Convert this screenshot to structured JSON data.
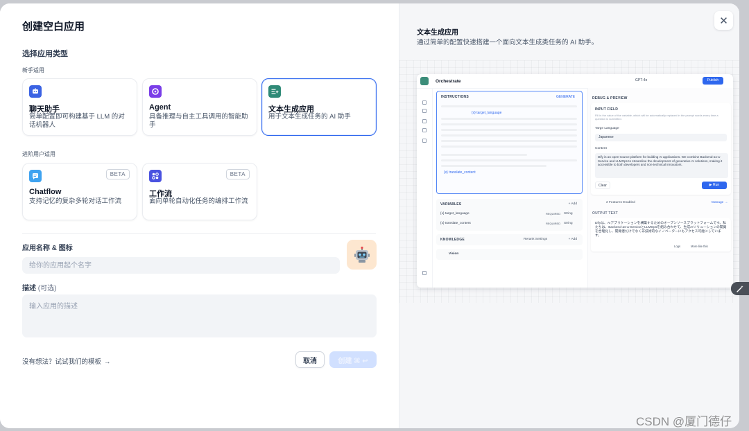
{
  "dialog": {
    "title": "创建空白应用",
    "section_title": "选择应用类型",
    "beginner_label": "新手适用",
    "advanced_label": "进阶用户适用"
  },
  "app_types": [
    {
      "name": "聊天助手",
      "desc": "简单配置即可构建基于 LLM 的对话机器人",
      "icon": "chat-bot-icon",
      "color": "#3b63e3",
      "selected": false
    },
    {
      "name": "Agent",
      "desc": "具备推理与自主工具调用的智能助手",
      "icon": "agent-icon",
      "color": "#7a3ee8",
      "selected": false
    },
    {
      "name": "文本生成应用",
      "desc": "用于文本生成任务的 AI 助手",
      "icon": "text-generation-icon",
      "color": "#2f8a77",
      "selected": true
    },
    {
      "name": "Chatflow",
      "desc": "支持记忆的复杂多轮对话工作流",
      "icon": "chatflow-icon",
      "color": "#3fa3f0",
      "badge": "BETA"
    },
    {
      "name": "工作流",
      "desc": "面向单轮自动化任务的编排工作流",
      "icon": "workflow-icon",
      "color": "#4a52e0",
      "badge": "BETA"
    }
  ],
  "form": {
    "name_label": "应用名称 & 图标",
    "name_placeholder": "给你的应用起个名字",
    "desc_label": "描述",
    "desc_optional": "(可选)",
    "desc_placeholder": "输入应用的描述",
    "template_link": "没有想法？试试我们的模板",
    "cancel_label": "取消",
    "create_label": "创建 ⌘ ↩"
  },
  "preview": {
    "title": "文本生成应用",
    "desc": "通过简单的配置快速搭建一个面向文本生成类任务的 AI 助手。",
    "orchestrate": "Orchestrate",
    "model": "GPT-4o",
    "publish": "Publish",
    "instructions": "INSTRUCTIONS",
    "generate": "GENERATE",
    "var_target": "{x} target_language",
    "var_content": "{x} translate_content",
    "variables": "VARIABLES",
    "add": "+ Add",
    "var1": "{x} target_language",
    "var2": "{x} translate_content",
    "required": "REQUIRED",
    "string_type": "String",
    "knowledge": "KNOWLEDGE",
    "rerank": "Rerank Settings",
    "vision": "Vision",
    "debug": "DEBUG & PREVIEW",
    "input_field": "INPUT FIELD",
    "input_hint": "Fill in the value of the variable, which will be automatically replaced in the prompt words every time a question is submitted.",
    "target_label": "Targe Language",
    "target_value": "Japanese",
    "content_label": "Content",
    "content_value": "Dify is an open-source platform for building AI applications. We combine Backend-as-a-Service and LLMOps to streamline the development of generative AI solutions, making it accessible to both developers and non-technical innovators.",
    "clear": "Clear",
    "run": "▶ Run",
    "features": "2 Features Enabled",
    "manage": "Manage →",
    "output_text": "OUTPUT TEXT",
    "output_value": "Difyは、AIアプリケーションを構築するためのオープンソースプラットフォームです。私たちは、Backend-as-a-ServiceとLLMOpsを組み合わせて、生成AIソリューションの開発を合理化し、開発者だけでなく非技術的なイノベーターにもアクセス可能にしています。",
    "logs": "Logs",
    "more": "More like this"
  },
  "watermark": "CSDN @厦门德仔"
}
